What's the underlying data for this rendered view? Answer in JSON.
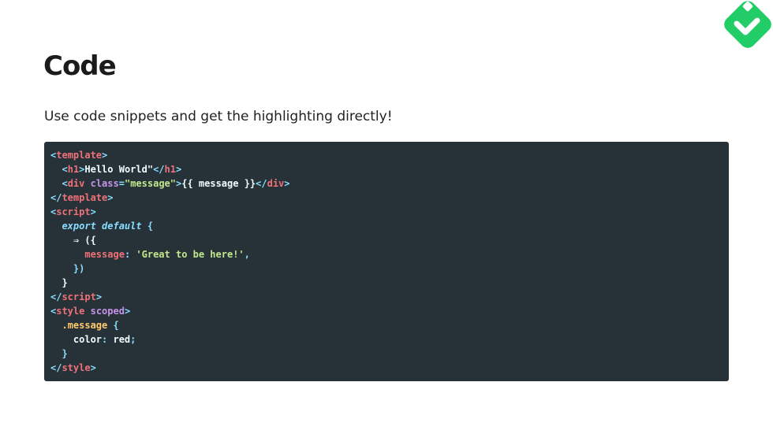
{
  "slide": {
    "title": "Code",
    "subtitle": "Use code snippets and get the highlighting directly!"
  },
  "logo": {
    "icon": "check-badge-icon",
    "color": "#22cc66"
  },
  "code": {
    "language": "vue",
    "background": "#263238",
    "lines": [
      [
        {
          "t": "<",
          "c": "punct"
        },
        {
          "t": "template",
          "c": "tag"
        },
        {
          "t": ">",
          "c": "punct"
        }
      ],
      [
        {
          "t": "  ",
          "c": "white"
        },
        {
          "t": "<",
          "c": "punct"
        },
        {
          "t": "h1",
          "c": "tag"
        },
        {
          "t": ">",
          "c": "punct"
        },
        {
          "t": "Hello World\"",
          "c": "white"
        },
        {
          "t": "</",
          "c": "punct"
        },
        {
          "t": "h1",
          "c": "tag"
        },
        {
          "t": ">",
          "c": "punct"
        }
      ],
      [
        {
          "t": "  ",
          "c": "white"
        },
        {
          "t": "<",
          "c": "punct"
        },
        {
          "t": "div",
          "c": "tag"
        },
        {
          "t": " ",
          "c": "white"
        },
        {
          "t": "class",
          "c": "attr"
        },
        {
          "t": "=",
          "c": "punct"
        },
        {
          "t": "\"message\"",
          "c": "string"
        },
        {
          "t": ">",
          "c": "punct"
        },
        {
          "t": "{{ message }}",
          "c": "white"
        },
        {
          "t": "</",
          "c": "punct"
        },
        {
          "t": "div",
          "c": "tag"
        },
        {
          "t": ">",
          "c": "punct"
        }
      ],
      [
        {
          "t": "</",
          "c": "punct"
        },
        {
          "t": "template",
          "c": "tag"
        },
        {
          "t": ">",
          "c": "punct"
        }
      ],
      [
        {
          "t": "<",
          "c": "punct"
        },
        {
          "t": "script",
          "c": "tag"
        },
        {
          "t": ">",
          "c": "punct"
        }
      ],
      [
        {
          "t": "  ",
          "c": "white"
        },
        {
          "t": "export default",
          "c": "keyword"
        },
        {
          "t": " {",
          "c": "punct"
        }
      ],
      [
        {
          "t": "    ",
          "c": "white"
        },
        {
          "t": "⇒ ({",
          "c": "white"
        }
      ],
      [
        {
          "t": "      ",
          "c": "white"
        },
        {
          "t": "message",
          "c": "tag"
        },
        {
          "t": ": ",
          "c": "punct"
        },
        {
          "t": "'Great to be here!'",
          "c": "string"
        },
        {
          "t": ",",
          "c": "punct"
        }
      ],
      [
        {
          "t": "    ",
          "c": "white"
        },
        {
          "t": "})",
          "c": "punct"
        }
      ],
      [
        {
          "t": "  ",
          "c": "white"
        },
        {
          "t": "}",
          "c": "white"
        }
      ],
      [
        {
          "t": "</",
          "c": "punct"
        },
        {
          "t": "script",
          "c": "tag"
        },
        {
          "t": ">",
          "c": "punct"
        }
      ],
      [
        {
          "t": "<",
          "c": "punct"
        },
        {
          "t": "style",
          "c": "tag"
        },
        {
          "t": " ",
          "c": "white"
        },
        {
          "t": "scoped",
          "c": "attr"
        },
        {
          "t": ">",
          "c": "punct"
        }
      ],
      [
        {
          "t": "  ",
          "c": "white"
        },
        {
          "t": ".message",
          "c": "selector"
        },
        {
          "t": " {",
          "c": "punct"
        }
      ],
      [
        {
          "t": "    ",
          "c": "white"
        },
        {
          "t": "color",
          "c": "white"
        },
        {
          "t": ": ",
          "c": "punct"
        },
        {
          "t": "red",
          "c": "white"
        },
        {
          "t": ";",
          "c": "punct"
        }
      ],
      [
        {
          "t": "  ",
          "c": "white"
        },
        {
          "t": "}",
          "c": "punct"
        }
      ],
      [
        {
          "t": "</",
          "c": "punct"
        },
        {
          "t": "style",
          "c": "tag"
        },
        {
          "t": ">",
          "c": "punct"
        }
      ]
    ]
  }
}
